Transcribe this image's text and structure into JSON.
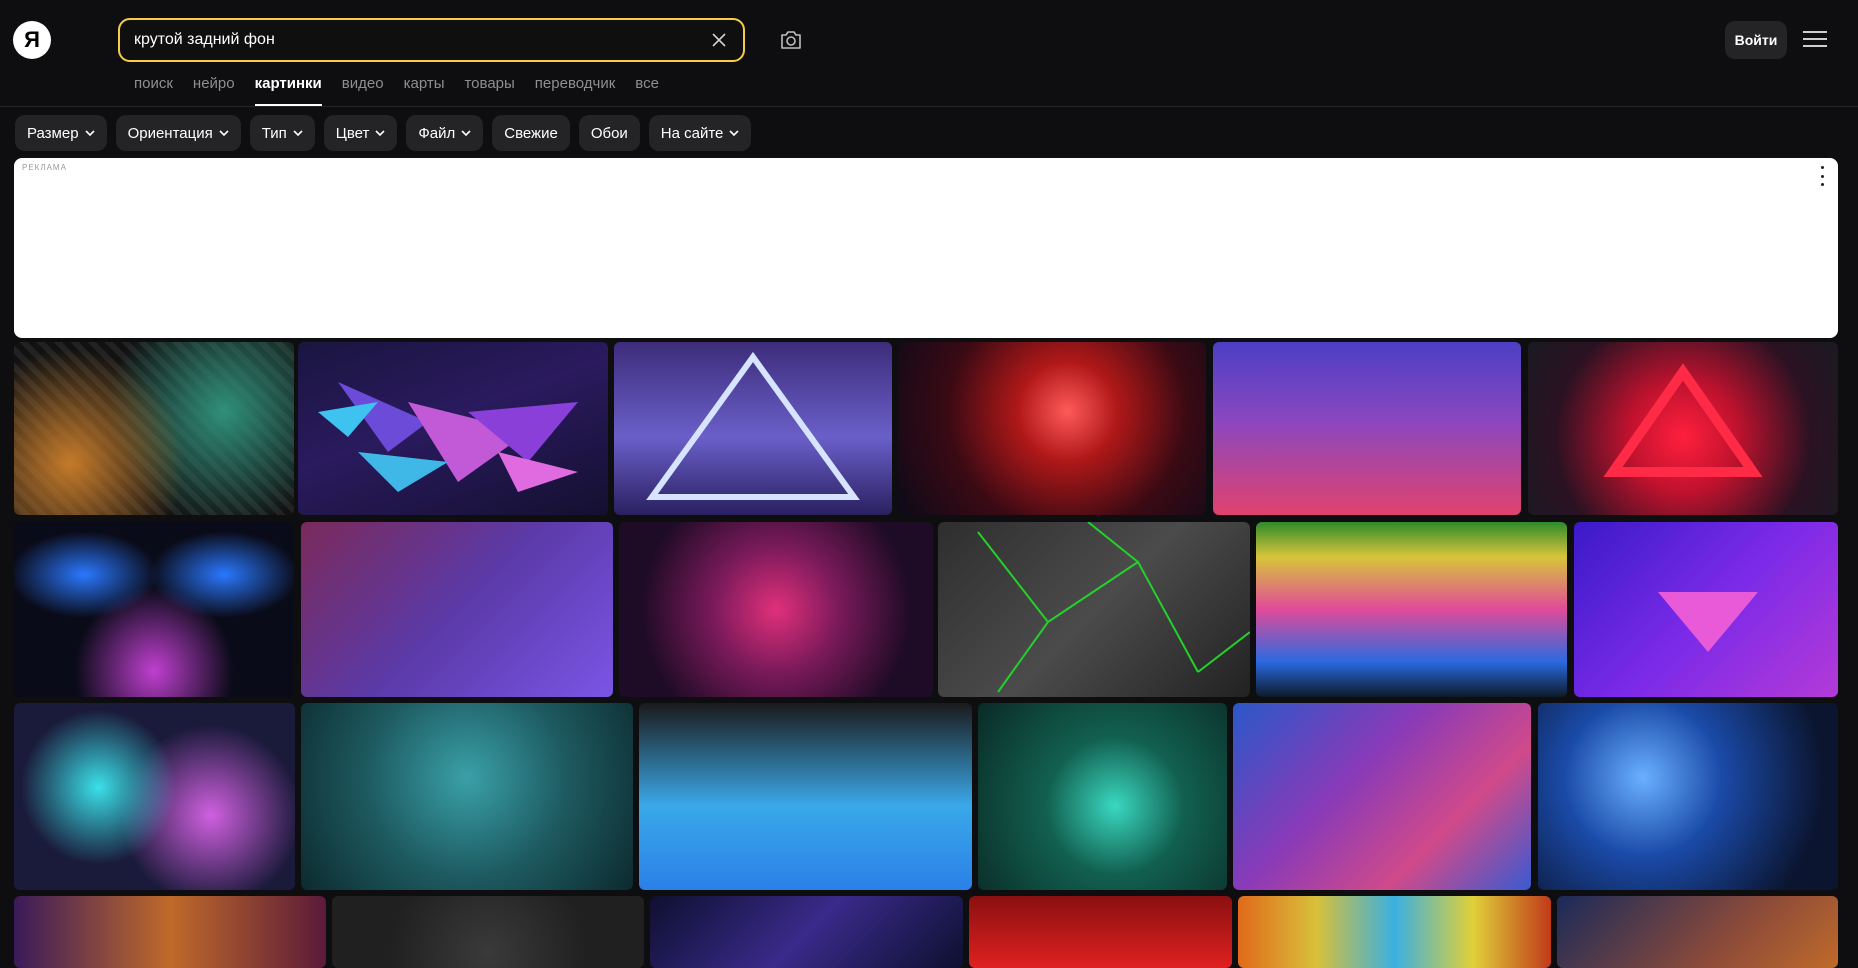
{
  "header": {
    "logo_letter": "Я",
    "search_value": "крутой задний фон",
    "login_label": "Войти"
  },
  "tabs": [
    {
      "label": "поиск",
      "active": false
    },
    {
      "label": "нейро",
      "active": false
    },
    {
      "label": "картинки",
      "active": true
    },
    {
      "label": "видео",
      "active": false
    },
    {
      "label": "карты",
      "active": false
    },
    {
      "label": "товары",
      "active": false
    },
    {
      "label": "переводчик",
      "active": false
    },
    {
      "label": "все",
      "active": false
    }
  ],
  "filters": [
    {
      "label": "Размер",
      "dropdown": true
    },
    {
      "label": "Ориентация",
      "dropdown": true
    },
    {
      "label": "Тип",
      "dropdown": true
    },
    {
      "label": "Цвет",
      "dropdown": true
    },
    {
      "label": "Файл",
      "dropdown": true
    },
    {
      "label": "Свежие",
      "dropdown": false
    },
    {
      "label": "Обои",
      "dropdown": false
    },
    {
      "label": "На сайте",
      "dropdown": true
    }
  ],
  "ad": {
    "label": "РЕКЛАМА"
  },
  "colors": {
    "accent": "#f6cd44",
    "background": "#0e0e10",
    "chip": "#242427"
  }
}
